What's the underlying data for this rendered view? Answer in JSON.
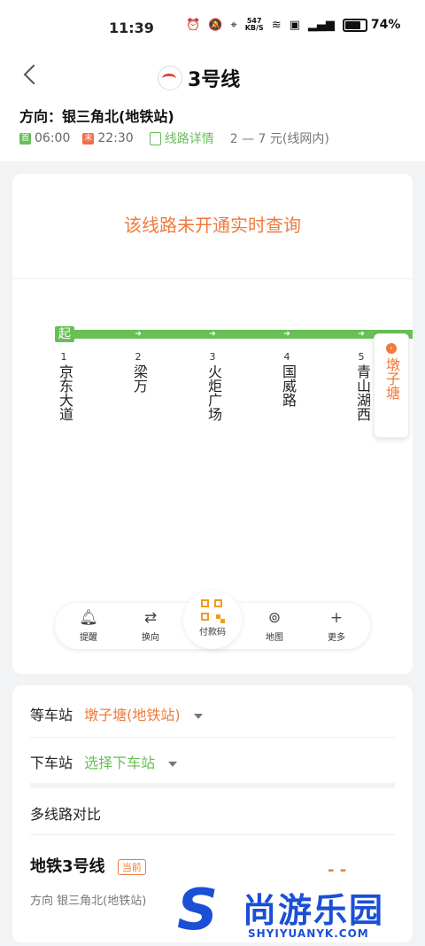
{
  "status_bar": {
    "time": "11:39",
    "speed_value": "547",
    "speed_unit": "KB/S",
    "battery": "74%"
  },
  "header": {
    "title": "3号线",
    "direction": "方向：银三角北(地铁站)",
    "first_badge": "首",
    "first_time": "06:00",
    "last_badge": "末",
    "last_time": "22:30",
    "detail_link": "线路详情",
    "fare": "2 — 7 元(线网内)"
  },
  "notice": "该线路未开通实时查询",
  "route": {
    "start_marker": "起",
    "stations": [
      {
        "num": "1",
        "name": "京东大道"
      },
      {
        "num": "2",
        "name": "梁万"
      },
      {
        "num": "3",
        "name": "火炬广场"
      },
      {
        "num": "4",
        "name": "国威路"
      },
      {
        "num": "5",
        "name": "青山湖西"
      }
    ],
    "current_station": "墩子塘"
  },
  "toolbar": {
    "remind": "提醒",
    "switch": "换向",
    "pay": "付款码",
    "map": "地图",
    "more": "更多"
  },
  "panel": {
    "wait_label": "等车站",
    "wait_value": "墩子塘(地铁站)",
    "off_label": "下车站",
    "off_value": "选择下车站",
    "compare": "多线路对比",
    "line_name": "地铁3号线",
    "current_tag": "当前",
    "line_direction": "方向 银三角北(地铁站)",
    "dash": "- -"
  },
  "watermark": {
    "cn": "尚游乐园",
    "en": "SHYIYUANYK.COM"
  },
  "colors": {
    "green": "#67bf55",
    "orange": "#f07a3c",
    "brand_blue": "#1a4fd6"
  }
}
